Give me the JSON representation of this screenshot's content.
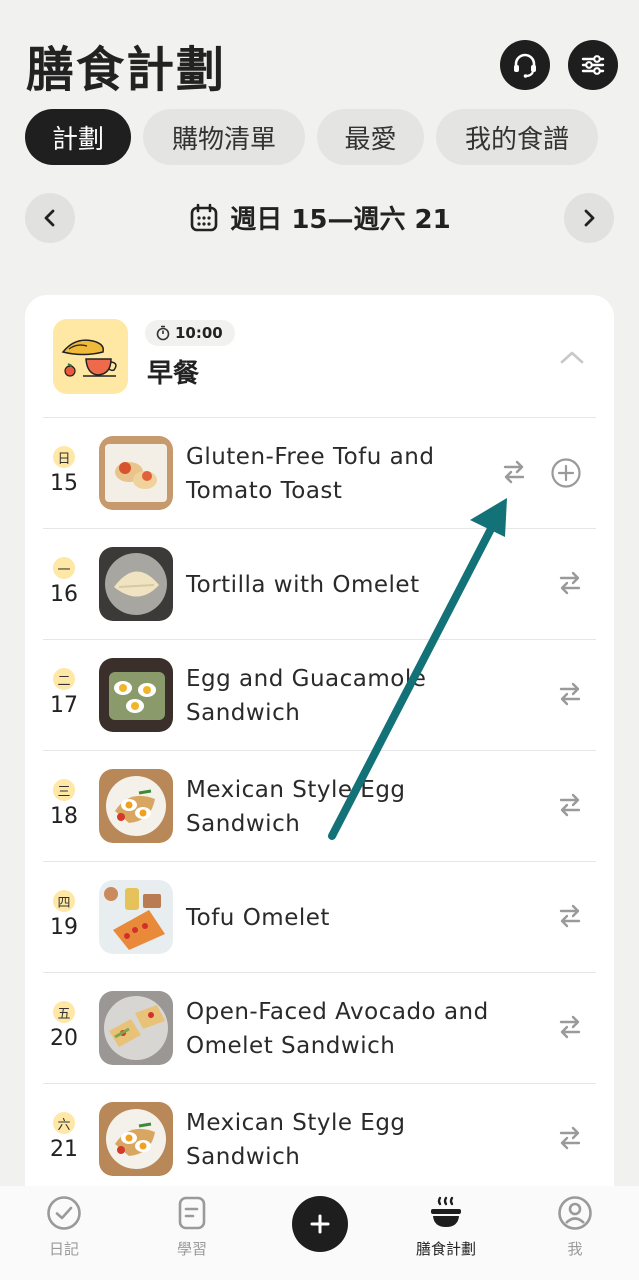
{
  "header": {
    "title": "膳食計劃"
  },
  "tabs": [
    {
      "label": "計劃",
      "active": true
    },
    {
      "label": "購物清單",
      "active": false
    },
    {
      "label": "最愛",
      "active": false
    },
    {
      "label": "我的食譜",
      "active": false
    }
  ],
  "week": {
    "label": "週日 15—週六 21"
  },
  "meal": {
    "time": "10:00",
    "name": "早餐"
  },
  "rows": [
    {
      "day": "日",
      "date": "15",
      "name": "Gluten-Free Tofu and Tomato Toast"
    },
    {
      "day": "一",
      "date": "16",
      "name": "Tortilla with Omelet"
    },
    {
      "day": "二",
      "date": "17",
      "name": "Egg and Guacamole Sandwich"
    },
    {
      "day": "三",
      "date": "18",
      "name": "Mexican Style Egg Sandwich"
    },
    {
      "day": "四",
      "date": "19",
      "name": "Tofu Omelet"
    },
    {
      "day": "五",
      "date": "20",
      "name": "Open-Faced Avocado and Omelet Sandwich"
    },
    {
      "day": "六",
      "date": "21",
      "name": "Mexican Style Egg Sandwich"
    }
  ],
  "bottom_nav": [
    {
      "label": "日記",
      "icon": "check-circle-icon"
    },
    {
      "label": "學習",
      "icon": "document-icon"
    },
    {
      "label": "膳食計劃",
      "icon": "bowl-icon",
      "active": true
    },
    {
      "label": "我",
      "icon": "profile-icon"
    }
  ],
  "colors": {
    "accent": "#1e1e1e",
    "badge": "#ffe7a6",
    "annotation_arrow": "#127277"
  }
}
